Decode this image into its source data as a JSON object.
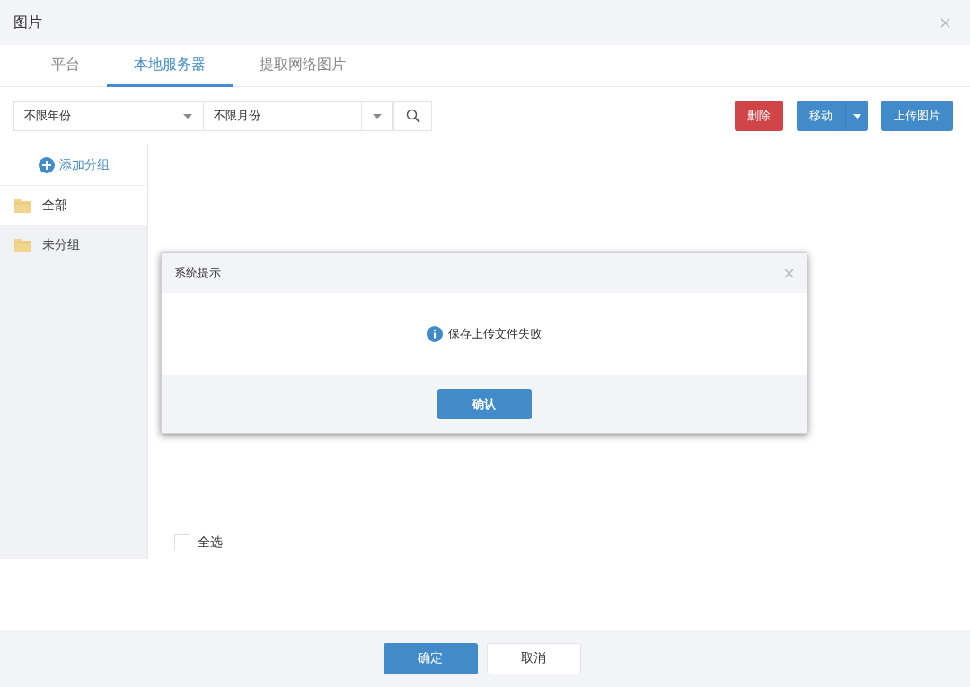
{
  "window": {
    "title": "图片"
  },
  "tabs": [
    {
      "label": "平台",
      "selected": false
    },
    {
      "label": "本地服务器",
      "selected": true
    },
    {
      "label": "提取网络图片",
      "selected": false
    }
  ],
  "filters": [
    {
      "value": "不限年份"
    },
    {
      "value": "不限月份"
    }
  ],
  "toolbar_buttons": [
    {
      "label": "删除",
      "kind": "danger"
    },
    {
      "label": "移动",
      "kind": "split"
    },
    {
      "label": "上传图片",
      "kind": "primary"
    }
  ],
  "sidebar": {
    "add_label": "添加分组",
    "items": [
      {
        "label": "全部",
        "selected": true
      },
      {
        "label": "未分组",
        "selected": false
      }
    ]
  },
  "select_all": {
    "label": "全选",
    "checked": false
  },
  "alert": {
    "title": "系统提示",
    "message": "保存上传文件失败",
    "button": "确认"
  },
  "footer_buttons": [
    {
      "label": "确定",
      "kind": "primary"
    },
    {
      "label": "取消",
      "kind": "default"
    }
  ]
}
